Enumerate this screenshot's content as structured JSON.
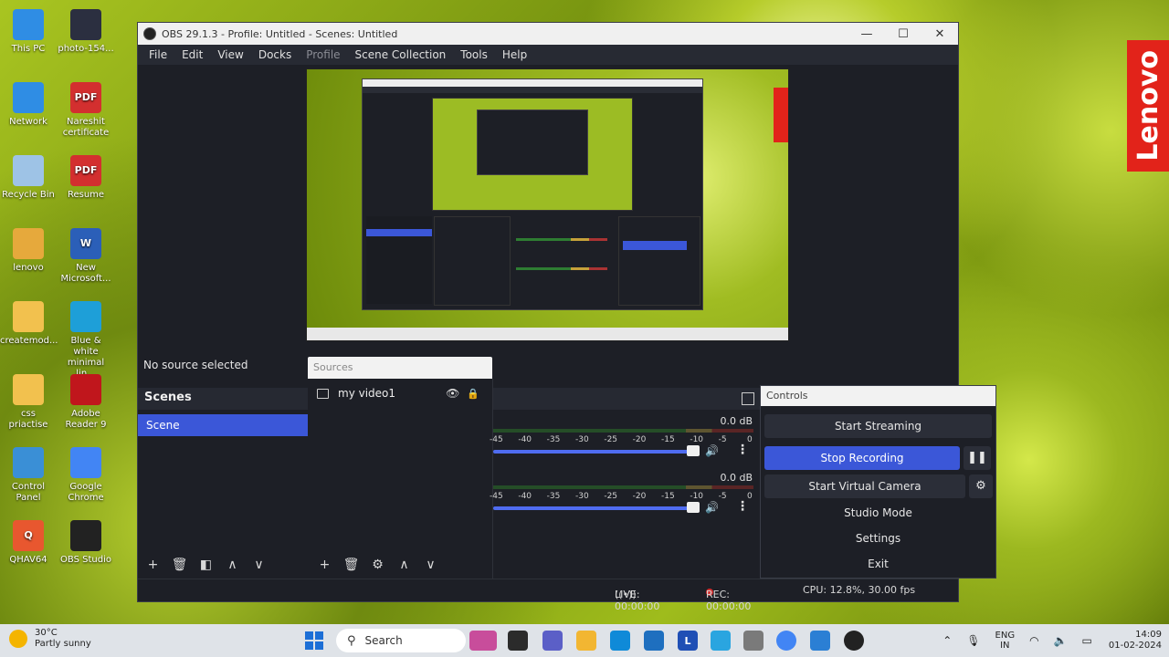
{
  "desktop": {
    "icons": [
      {
        "label": "This PC",
        "color": "#2f8de4",
        "glyph": ""
      },
      {
        "label": "photo-154...",
        "color": "#2b2f40",
        "glyph": ""
      },
      {
        "label": "Network",
        "color": "#2f8de4",
        "glyph": ""
      },
      {
        "label": "Nareshit certificate",
        "color": "#d32f2f",
        "glyph": "PDF"
      },
      {
        "label": "Recycle Bin",
        "color": "#9ec3e6",
        "glyph": ""
      },
      {
        "label": "Resume",
        "color": "#d32f2f",
        "glyph": "PDF"
      },
      {
        "label": "lenovo",
        "color": "#e6a93c",
        "glyph": ""
      },
      {
        "label": "New Microsoft...",
        "color": "#2b5fb8",
        "glyph": "W"
      },
      {
        "label": "createmod...",
        "color": "#f2c14e",
        "glyph": ""
      },
      {
        "label": "Blue & white minimal lin...",
        "color": "#1e9fd8",
        "glyph": ""
      },
      {
        "label": "css priactise",
        "color": "#f2c14e",
        "glyph": ""
      },
      {
        "label": "Adobe Reader 9",
        "color": "#c0161c",
        "glyph": ""
      },
      {
        "label": "Control Panel",
        "color": "#3a8fd6",
        "glyph": ""
      },
      {
        "label": "Google Chrome",
        "color": "#4285f4",
        "glyph": ""
      },
      {
        "label": "QHAV64",
        "color": "#e8572f",
        "glyph": "Q"
      },
      {
        "label": "OBS Studio",
        "color": "#222222",
        "glyph": ""
      }
    ],
    "lenovo_logo": "Lenovo"
  },
  "window": {
    "title": "OBS 29.1.3 - Profile: Untitled - Scenes: Untitled",
    "controls": [
      "—",
      "☐",
      "✕"
    ]
  },
  "menu": [
    "File",
    "Edit",
    "View",
    "Docks",
    "Profile",
    "Scene Collection",
    "Tools",
    "Help"
  ],
  "status_no_source": "No source selected",
  "scenes": {
    "title": "Scenes",
    "items": [
      "Scene"
    ],
    "toolbar": [
      "+",
      "🗑",
      "◧",
      "∧",
      "∨"
    ]
  },
  "sources": {
    "tab_label": "Sources",
    "items": [
      {
        "name": "my video1"
      }
    ],
    "toolbar": [
      "+",
      "🗑",
      "⚙",
      "∧",
      "∨"
    ]
  },
  "mixer": {
    "channels": [
      {
        "db": "0.0 dB",
        "volume": 0.95
      },
      {
        "db": "0.0 dB",
        "volume": 0.95
      }
    ],
    "ticks": [
      "-45",
      "-40",
      "-35",
      "-30",
      "-25",
      "-20",
      "-15",
      "-10",
      "-5",
      "0"
    ]
  },
  "controls": {
    "title": "Controls",
    "start_streaming": "Start Streaming",
    "stop_recording": "Stop Recording",
    "start_virtual_camera": "Start Virtual Camera",
    "studio_mode": "Studio Mode",
    "settings": "Settings",
    "exit": "Exit"
  },
  "statusbar": {
    "live": "LIVE: 00:00:00",
    "rec": "REC: 00:00:00",
    "cpu": "CPU: 12.8%, 30.00 fps"
  },
  "taskbar": {
    "temp": "30°C",
    "weather": "Partly sunny",
    "search": "Search",
    "lang1": "ENG",
    "lang2": "IN",
    "time": "14:09",
    "date": "01-02-2024"
  },
  "colors": {
    "accent": "#3b57d8",
    "panel": "#1d1f26",
    "rec": "#d32f2f"
  }
}
